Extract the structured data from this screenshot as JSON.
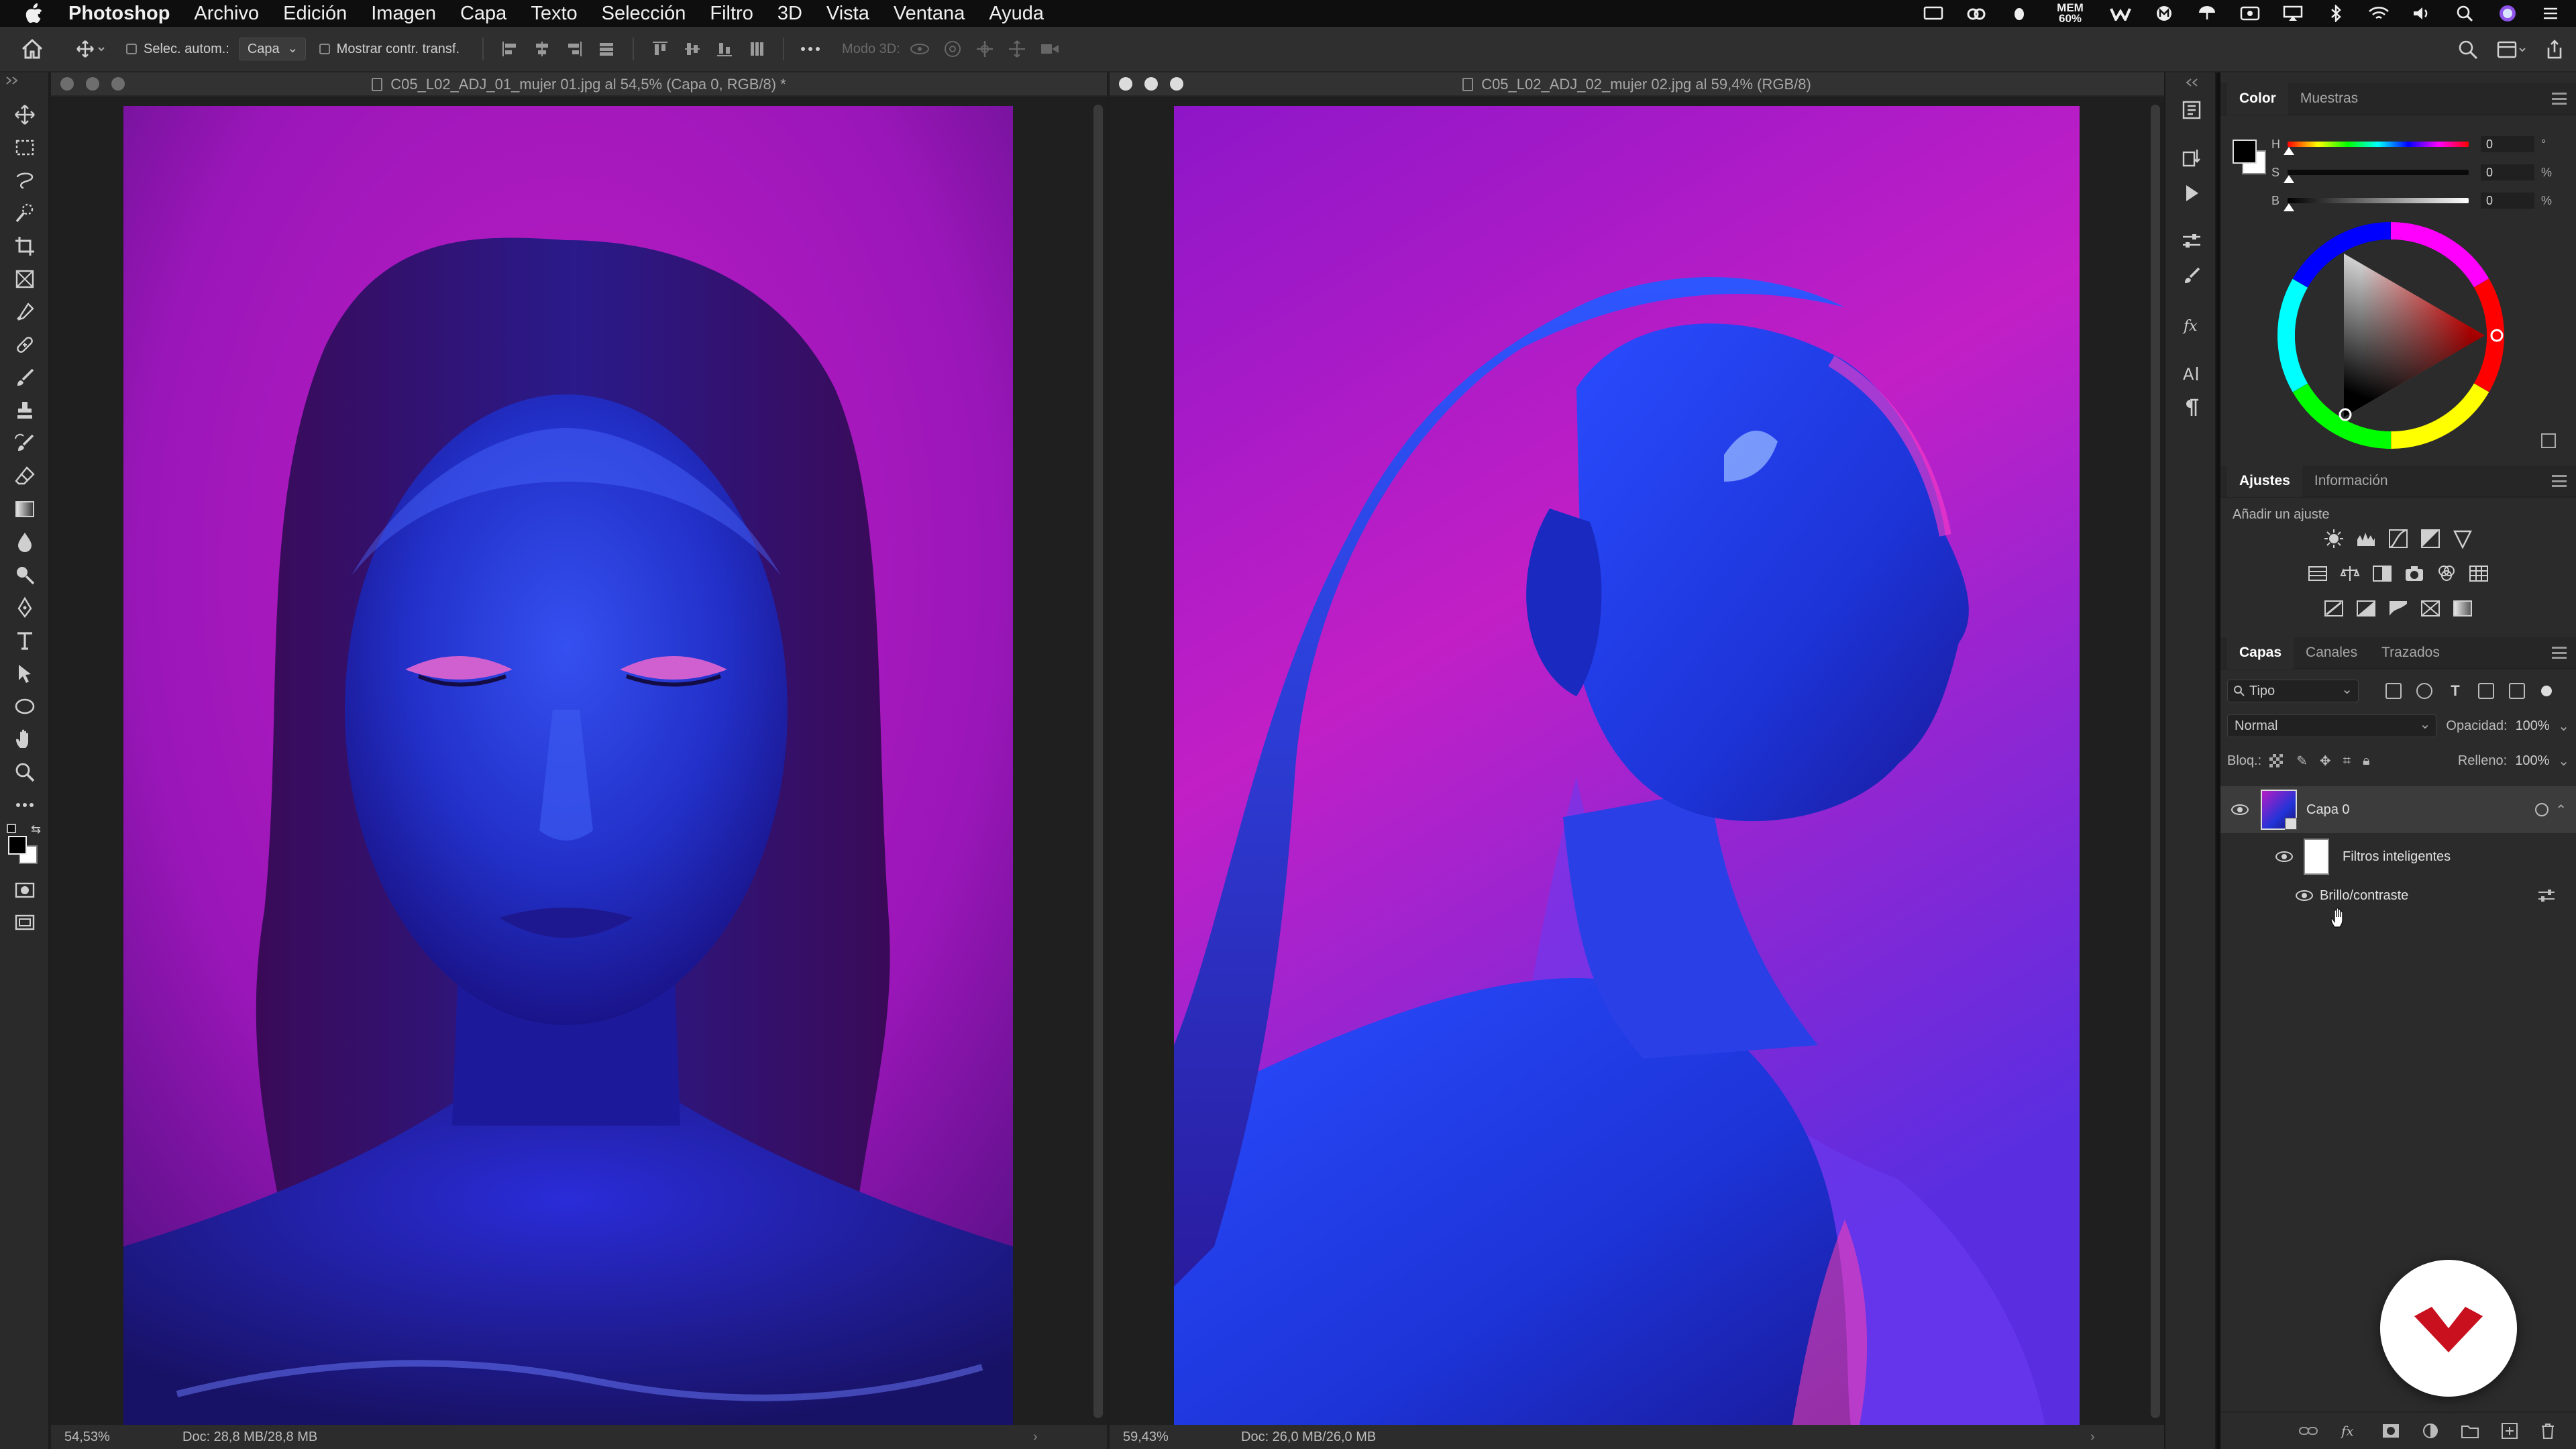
{
  "menubar": {
    "app_name": "Photoshop",
    "menus": [
      "Archivo",
      "Edición",
      "Imagen",
      "Capa",
      "Texto",
      "Selección",
      "Filtro",
      "3D",
      "Vista",
      "Ventana",
      "Ayuda"
    ],
    "mem_label": "MEM",
    "mem_value": "60%"
  },
  "options_bar": {
    "auto_select_label": "Selec. autom.:",
    "auto_select_target": "Capa",
    "show_transform_label": "Mostrar contr. transf.",
    "mode_3d_label": "Modo 3D:"
  },
  "documents": [
    {
      "title": "C05_L02_ADJ_01_mujer 01.jpg al 54,5% (Capa 0, RGB/8) *",
      "zoom": "54,53%",
      "doc_info": "Doc: 28,8 MB/28,8 MB",
      "active": true
    },
    {
      "title": "C05_L02_ADJ_02_mujer 02.jpg al 59,4% (RGB/8)",
      "zoom": "59,43%",
      "doc_info": "Doc: 26,0 MB/26,0 MB",
      "active": false
    }
  ],
  "color_panel": {
    "tabs": [
      "Color",
      "Muestras"
    ],
    "sliders": [
      {
        "label": "H",
        "value": "0",
        "unit": "°"
      },
      {
        "label": "S",
        "value": "0",
        "unit": "%"
      },
      {
        "label": "B",
        "value": "0",
        "unit": "%"
      }
    ],
    "foreground": "#000000",
    "background": "#ffffff"
  },
  "adjustments_panel": {
    "tabs": [
      "Ajustes",
      "Información"
    ],
    "subtitle": "Añadir un ajuste"
  },
  "layers_panel": {
    "tabs": [
      "Capas",
      "Canales",
      "Trazados"
    ],
    "filter_kind": "Tipo",
    "blend_mode": "Normal",
    "opacity_label": "Opacidad:",
    "opacity_value": "100%",
    "lock_label": "Bloq.:",
    "fill_label": "Relleno:",
    "fill_value": "100%",
    "layers": [
      {
        "name": "Capa 0"
      },
      {
        "name": "Filtros inteligentes"
      },
      {
        "name": "Brillo/contraste"
      }
    ]
  },
  "colors": {
    "menubar_bg": "#0e0e0e",
    "panel_bg": "#2b2b2b",
    "canvas_bg": "#1f1f1f",
    "photo_magenta": "#c21fc6",
    "photo_blue": "#1d37e0",
    "brand_red": "#c8101e"
  }
}
